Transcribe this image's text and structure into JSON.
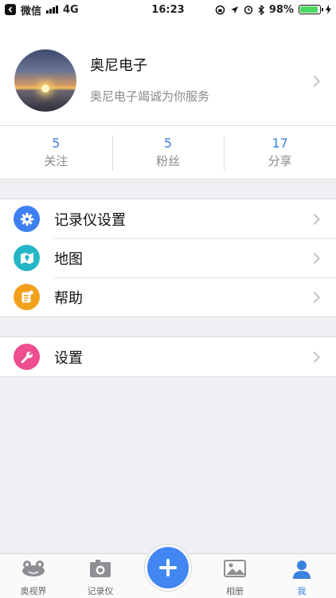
{
  "status_bar": {
    "carrier": "微信",
    "network": "4G",
    "time": "16:23",
    "battery": "98%",
    "battery_level": 0.98
  },
  "profile": {
    "name": "奥尼电子",
    "motto": "奥尼电子竭诚为你服务"
  },
  "stats": [
    {
      "value": "5",
      "label": "关注"
    },
    {
      "value": "5",
      "label": "粉丝"
    },
    {
      "value": "17",
      "label": "分享"
    }
  ],
  "menu": {
    "recorder_settings": {
      "label": "记录仪设置",
      "icon": "gear-icon",
      "color": "#3d7ff0"
    },
    "map": {
      "label": "地图",
      "icon": "map-icon",
      "color": "#24b6c6"
    },
    "help": {
      "label": "帮助",
      "icon": "help-doc-icon",
      "color": "#f2a11d"
    },
    "settings": {
      "label": "设置",
      "icon": "wrench-icon",
      "color": "#ee4d8f"
    }
  },
  "tabbar": {
    "tabs": [
      {
        "label": "奥视界",
        "icon": "frog-icon"
      },
      {
        "label": "记录仪",
        "icon": "camera-icon"
      },
      {
        "label": "相册",
        "icon": "photo-icon"
      },
      {
        "label": "我",
        "icon": "person-icon",
        "active": true
      }
    ],
    "center_icon": "plus-icon",
    "accent": "#3b82e0"
  }
}
